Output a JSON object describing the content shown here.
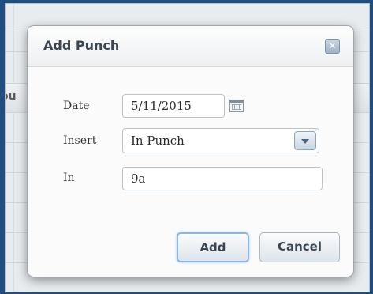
{
  "background": {
    "column_header_fragment": "ou"
  },
  "dialog": {
    "title": "Add Punch",
    "close_icon": "close-icon",
    "fields": {
      "date": {
        "label": "Date",
        "value": "5/11/2015"
      },
      "insert": {
        "label": "Insert",
        "value": "In Punch"
      },
      "in": {
        "label": "In",
        "value": "9a"
      }
    },
    "buttons": {
      "add": "Add",
      "cancel": "Cancel"
    }
  },
  "colors": {
    "frame": "#1f4f80",
    "dialog_bg": "#fbfbfb",
    "button_focus": "#8cb8e0"
  }
}
